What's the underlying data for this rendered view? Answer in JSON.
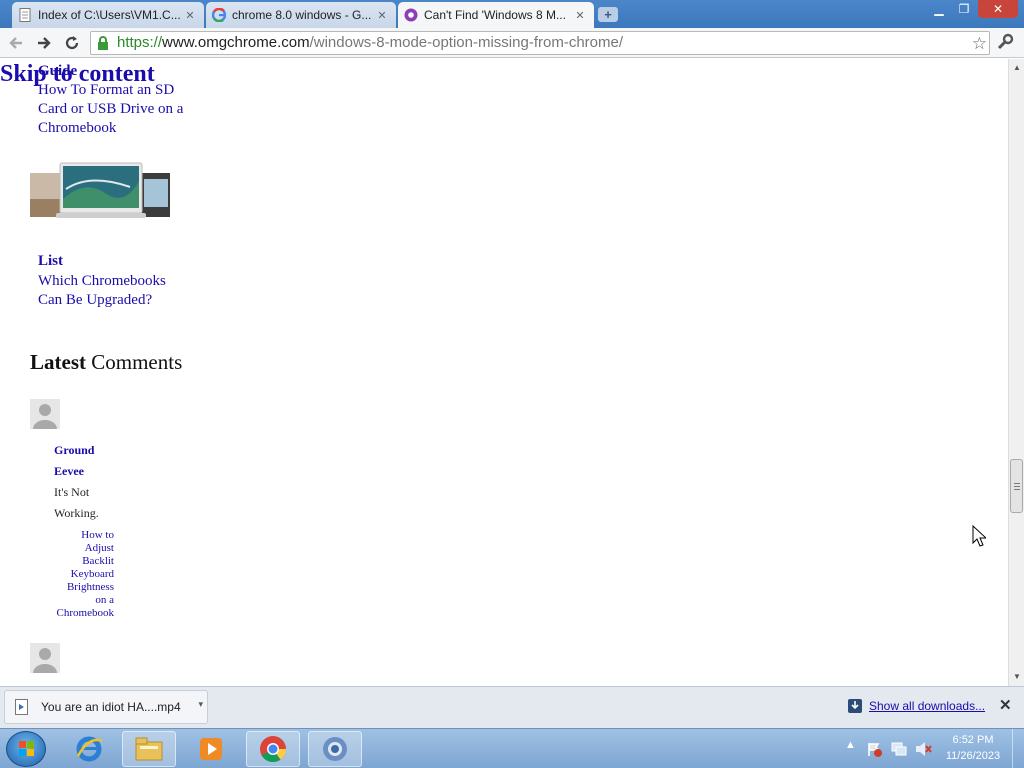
{
  "browser": {
    "tabs": [
      {
        "title": "Index of C:\\Users\\VM1.C...",
        "icon": "file-icon",
        "active": false
      },
      {
        "title": "chrome 8.0 windows - G...",
        "icon": "google-icon",
        "active": false
      },
      {
        "title": "Can't Find 'Windows 8 M...",
        "icon": "omgchrome-icon",
        "active": true
      }
    ],
    "url": {
      "scheme": "https://",
      "host": "www.omgchrome.com",
      "path": "/windows-8-mode-option-missing-from-chrome/"
    }
  },
  "page": {
    "skip_link": "Skip to content",
    "articles": [
      {
        "category": "Guide",
        "title": "How To Format an SD Card or USB Drive on a Chromebook"
      },
      {
        "category": "List",
        "title": "Which Chromebooks Can Be Upgraded?"
      }
    ],
    "latest_comments": {
      "bold": "Latest",
      "rest": " Comments"
    },
    "comments": [
      {
        "author_line1": "Ground",
        "author_line2": "Eevee",
        "text_line1": "It's Not",
        "text_line2": "Working.",
        "post_lines": [
          "How to",
          "Adjust",
          "Backlit",
          "Keyboard",
          "Brightness",
          "on a",
          "Chromebook"
        ]
      }
    ]
  },
  "downloads": {
    "item": "You are an idiot HA....mp4",
    "show_all": "Show all downloads...",
    "close": "✕"
  },
  "taskbar": {
    "clock_time": "6:52 PM",
    "clock_date": "11/26/2023",
    "tray_arrow": "▲"
  }
}
